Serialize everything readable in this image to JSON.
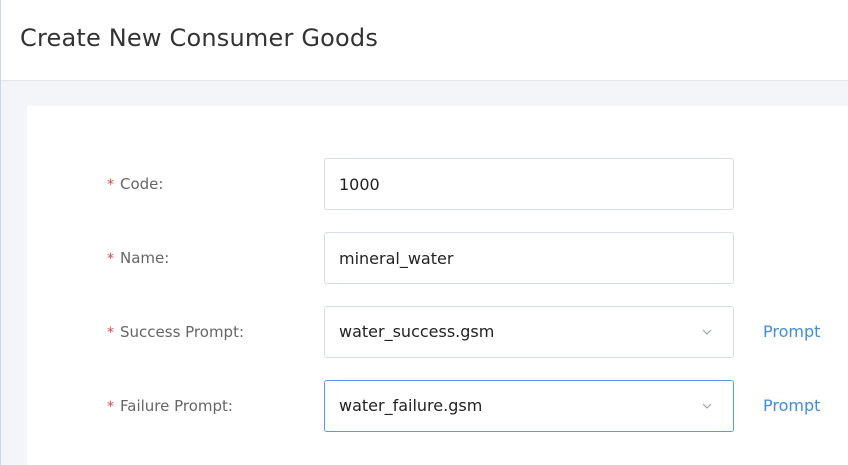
{
  "window": {
    "title": "Create New Consumer Goods"
  },
  "form": {
    "code": {
      "label": "Code:",
      "value": "1000",
      "required": true
    },
    "name": {
      "label": "Name:",
      "value": "mineral_water",
      "required": true
    },
    "success_prompt": {
      "label": "Success Prompt:",
      "selected": "water_success.gsm",
      "link_label": "Prompt",
      "required": true
    },
    "failure_prompt": {
      "label": "Failure Prompt:",
      "selected": "water_failure.gsm",
      "link_label": "Prompt",
      "required": true
    },
    "required_marker": "*"
  },
  "icons": {
    "select_arrow": "chevron-down-icon"
  },
  "colors": {
    "required": "#e64545",
    "link": "#3f8ce0",
    "focus_border": "#5b9ae6",
    "background": "#f3f5f8"
  }
}
